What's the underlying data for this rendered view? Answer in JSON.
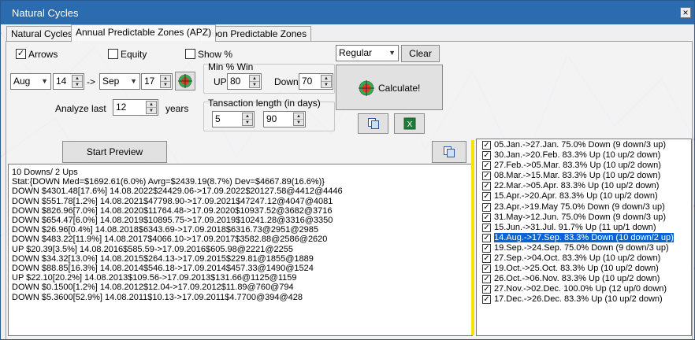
{
  "window": {
    "title": "Natural Cycles",
    "close_glyph": "×"
  },
  "tabs": [
    {
      "label": "Natural Cycles"
    },
    {
      "label": "Annual Predictable Zones (APZ)"
    },
    {
      "label": "Moon Predictable Zones"
    }
  ],
  "options": {
    "arrows_label": "Arrows",
    "arrows_checked": true,
    "equity_label": "Equity",
    "equity_checked": false,
    "showpct_label": "Show %",
    "showpct_checked": false
  },
  "range": {
    "from_month": "Aug",
    "from_day": "14",
    "arrow_text": "->",
    "to_month": "Sep",
    "to_day": "17"
  },
  "analyze": {
    "label": "Analyze last",
    "value": "12",
    "unit": "years"
  },
  "minwin": {
    "label": "Min % Win",
    "up_label": "UP",
    "up_value": "80",
    "down_label": "Down",
    "down_value": "70"
  },
  "transaction": {
    "label": "Tansaction length (in days)",
    "min_value": "5",
    "max_value": "90"
  },
  "mode": {
    "selected": "Regular"
  },
  "buttons": {
    "clear": "Clear",
    "calculate": "Calculate!",
    "start_preview": "Start Preview"
  },
  "icons": {
    "target": "target-icon",
    "copy": "copy-icon",
    "excel": "excel-icon",
    "copy_list": "copy-icon"
  },
  "output_lines": [
    "10 Downs/ 2 Ups",
    "Stat:{DOWN Med=$1692.61(6.0%) Avrg=$2439.19(8.7%) Dev=$4667.89(16.6%)}",
    "DOWN $4301.48[17.6%] 14.08.2022$24429.06->17.09.2022$20127.58@4412@4446",
    "DOWN $551.78[1.2%] 14.08.2021$47798.90->17.09.2021$47247.12@4047@4081",
    "DOWN $826.96[7.0%] 14.08.2020$11764.48->17.09.2020$10937.52@3682@3716",
    "DOWN $654.47[6.0%] 14.08.2019$10895.75->17.09.2019$10241.28@3316@3350",
    "DOWN $26.96[0.4%] 14.08.2018$6343.69->17.09.2018$6316.73@2951@2985",
    "DOWN $483.22[11.9%] 14.08.2017$4066.10->17.09.2017$3582.88@2586@2620",
    "UP $20.39[3.5%] 14.08.2016$585.59->17.09.2016$605.98@2221@2255",
    "DOWN $34.32[13.0%] 14.08.2015$264.13->17.09.2015$229.81@1855@1889",
    "DOWN $88.85[16.3%] 14.08.2014$546.18->17.09.2014$457.33@1490@1524",
    "UP $22.10[20.2%] 14.08.2013$109.56->17.09.2013$131.66@1125@1159",
    "DOWN $0.1500[1.2%] 14.08.2012$12.04->17.09.2012$11.89@760@794",
    "DOWN $5.3600[52.9%] 14.08.2011$10.13->17.09.2011$4.7700@394@428"
  ],
  "zones": [
    {
      "text": "05.Jan.->27.Jan.  75.0% Down (9 down/3 up)",
      "checked": true,
      "selected": false
    },
    {
      "text": "30.Jan.->20.Feb.  83.3% Up (10 up/2 down)",
      "checked": true,
      "selected": false
    },
    {
      "text": "27.Feb.->05.Mar.  83.3% Up (10 up/2 down)",
      "checked": true,
      "selected": false
    },
    {
      "text": "08.Mar.->15.Mar.  83.3% Up (10 up/2 down)",
      "checked": true,
      "selected": false
    },
    {
      "text": "22.Mar.->05.Apr.  83.3% Up (10 up/2 down)",
      "checked": true,
      "selected": false
    },
    {
      "text": "15.Apr.->20.Apr.  83.3% Up (10 up/2 down)",
      "checked": true,
      "selected": false
    },
    {
      "text": "23.Apr.->19.May  75.0% Down (9 down/3 up)",
      "checked": true,
      "selected": false
    },
    {
      "text": "31.May->12.Jun.  75.0% Down (9 down/3 up)",
      "checked": true,
      "selected": false
    },
    {
      "text": "15.Jun.->31.Jul.  91.7% Up (11 up/1 down)",
      "checked": true,
      "selected": false
    },
    {
      "text": "14.Aug.->17.Sep.  83.3% Down (10 down/2 up)",
      "checked": true,
      "selected": true
    },
    {
      "text": "19.Sep.->24.Sep.  75.0% Down (9 down/3 up)",
      "checked": true,
      "selected": false
    },
    {
      "text": "27.Sep.->04.Oct.  83.3% Up (10 up/2 down)",
      "checked": true,
      "selected": false
    },
    {
      "text": "19.Oct.->25.Oct.  83.3% Up (10 up/2 down)",
      "checked": true,
      "selected": false
    },
    {
      "text": "26.Oct.->06.Nov.  83.3% Up (10 up/2 down)",
      "checked": true,
      "selected": false
    },
    {
      "text": "27.Nov.->02.Dec.  100.0% Up (12 up/0 down)",
      "checked": true,
      "selected": false
    },
    {
      "text": "17.Dec.->26.Dec.  83.3% Up (10 up/2 down)",
      "checked": true,
      "selected": false
    }
  ],
  "colors": {
    "titlebar": "#2b6cb0",
    "highlight": "#0a64d6",
    "divider": "#f4e400"
  }
}
